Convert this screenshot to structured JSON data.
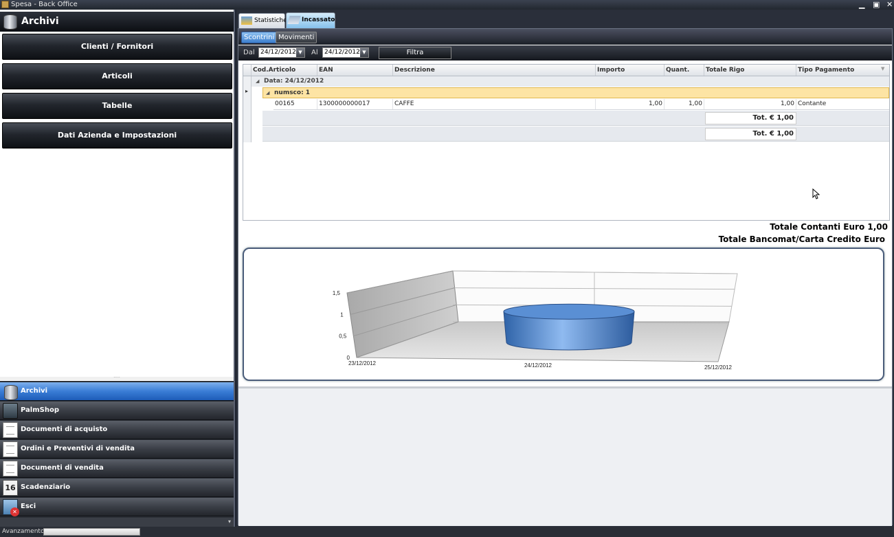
{
  "window": {
    "title": "Spesa - Back Office",
    "minimize": "▁",
    "restore": "▣",
    "close": "✕"
  },
  "left": {
    "header": "Archivi",
    "buttons": [
      "Clienti / Fornitori",
      "Articoli",
      "Tabelle",
      "Dati Azienda e Impostazioni"
    ],
    "splitter": "·····",
    "nav": [
      "Archivi",
      "PalmShop",
      "Documenti di acquisto",
      "Ordini e Preventivi di vendita",
      "Documenti di vendita",
      "Scadenziario",
      "Esci"
    ],
    "calendar_day": "16",
    "scroll_arrow": "▾"
  },
  "status": {
    "label": "Avanzamento",
    "progress": 0
  },
  "tabs": [
    {
      "label": "Statistiche",
      "active": false
    },
    {
      "label": "Incassato",
      "active": true
    }
  ],
  "subtabs": [
    {
      "label": "Scontrini",
      "active": true
    },
    {
      "label": "Movimenti",
      "active": false
    }
  ],
  "filter": {
    "dal_label": "Dal",
    "dal_value": "24/12/2012",
    "al_label": "Al",
    "al_value": "24/12/2012",
    "filtra": "Filtra",
    "dd_glyph": "▼"
  },
  "grid": {
    "columns": [
      "Cod.Articolo",
      "EAN",
      "Descrizione",
      "Importo",
      "Quant.",
      "Totale Rigo",
      "Tipo Pagamento"
    ],
    "sort_glyph": "▼",
    "expand_glyph": "◢",
    "row_marker": "▸",
    "group1": "Data: 24/12/2012",
    "group2": "numsco: 1",
    "rows": [
      {
        "cod": "00165",
        "ean": "1300000000017",
        "descrizione": "CAFFE",
        "importo": "1,00",
        "quant": "1,00",
        "totale": "1,00",
        "tipo": "Contante"
      }
    ],
    "subtotal": "Tot. € 1,00",
    "total": "Tot. € 1,00"
  },
  "totals": {
    "contanti": "Totale Contanti Euro 1,00",
    "bancomat": "Totale Bancomat/Carta Credito Euro"
  },
  "chart_data": {
    "type": "bar",
    "categories": [
      "23/12/2012",
      "24/12/2012",
      "25/12/2012"
    ],
    "values": [
      0,
      1,
      0
    ],
    "ylim": [
      0,
      1.5
    ],
    "yticks": [
      "0",
      "0,5",
      "1",
      "1,5"
    ],
    "series_color": "#4d86d0",
    "style": "3d-cylinder",
    "grid": true
  }
}
